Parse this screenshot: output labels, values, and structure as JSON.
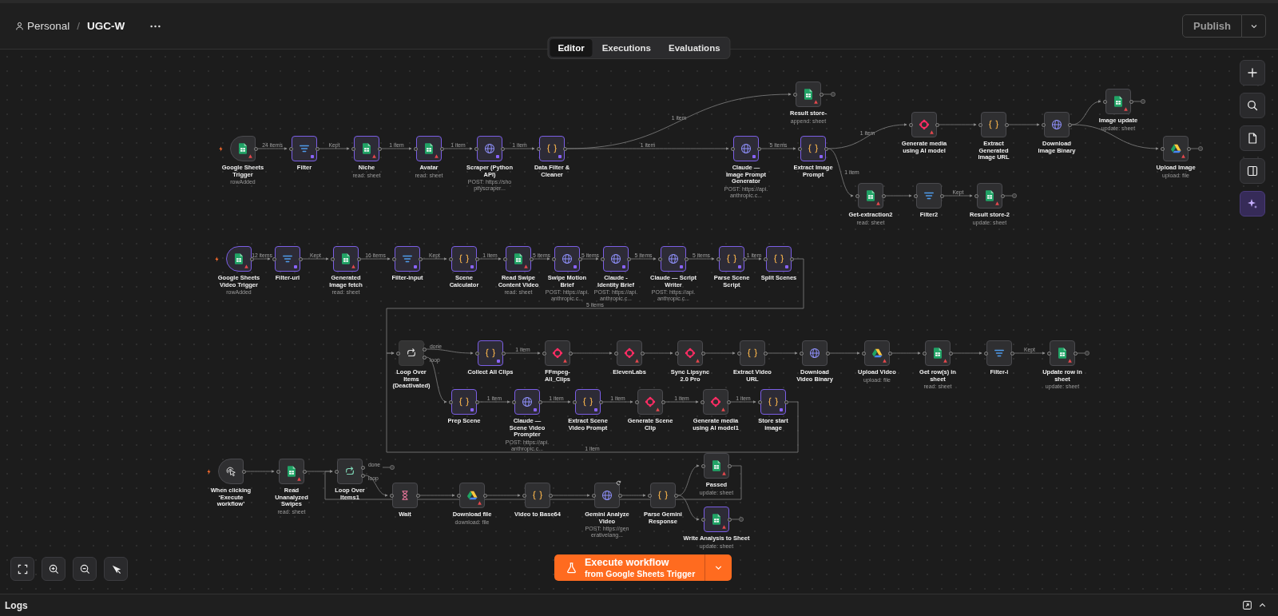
{
  "header": {
    "workspace": "Personal",
    "separator": "/",
    "workflow_name": "UGC-W",
    "publish_button": "Publish"
  },
  "tabs": [
    {
      "label": "Editor",
      "selected": true
    },
    {
      "label": "Executions",
      "selected": false
    },
    {
      "label": "Evaluations",
      "selected": false
    }
  ],
  "nodes": [
    {
      "name": "Google Sheets Trigger",
      "subtitle": "rowAdded",
      "kind": "sheets",
      "trigger": true,
      "pinned": false,
      "warning": true,
      "disabled": false,
      "out_labels": [
        "24 items"
      ]
    },
    {
      "name": "Filter",
      "kind": "filter",
      "trigger": false,
      "pinned": true,
      "warning": false,
      "disabled": false,
      "out_labels": [
        "Kept"
      ]
    },
    {
      "name": "Niche",
      "subtitle": "read: sheet",
      "kind": "sheets",
      "trigger": false,
      "pinned": true,
      "warning": true,
      "disabled": false,
      "out_labels": [
        "1 item"
      ]
    },
    {
      "name": "Avatar",
      "subtitle": "read: sheet",
      "kind": "sheets",
      "trigger": false,
      "pinned": true,
      "warning": true,
      "disabled": false,
      "out_labels": [
        "1 item"
      ]
    },
    {
      "name": "Scraper (Python API)",
      "subtitle": "POST: https://shopifyscraper...",
      "kind": "http",
      "trigger": false,
      "pinned": true,
      "warning": false,
      "disabled": false,
      "out_labels": [
        "1 item"
      ]
    },
    {
      "name": "Data Filter & Cleaner",
      "kind": "code",
      "trigger": false,
      "pinned": true,
      "warning": false,
      "disabled": false,
      "out_labels": [
        "1 item",
        "1 item"
      ]
    },
    {
      "name": "Result store-",
      "subtitle": "append: sheet",
      "kind": "sheets",
      "trigger": false,
      "pinned": false,
      "warning": true,
      "disabled": false,
      "end_handle": true
    },
    {
      "name": "Claude — Image Prompt Generator",
      "subtitle": "POST: https://api.anthropic.c...",
      "kind": "http",
      "trigger": false,
      "pinned": true,
      "warning": false,
      "disabled": false,
      "out_labels": [
        "5 items"
      ]
    },
    {
      "name": "Extract Image Prompt",
      "kind": "code",
      "trigger": false,
      "pinned": true,
      "warning": false,
      "disabled": false,
      "out_labels": [
        "1 item",
        "1 item"
      ]
    },
    {
      "name": "Generate media using AI model",
      "kind": "ai",
      "trigger": false,
      "pinned": false,
      "warning": true,
      "disabled": false
    },
    {
      "name": "Extract Generated Image URL",
      "kind": "code",
      "trigger": false,
      "pinned": false,
      "warning": false,
      "disabled": false
    },
    {
      "name": "Download Image Binary",
      "kind": "http",
      "trigger": false,
      "pinned": false,
      "warning": false,
      "disabled": false
    },
    {
      "name": "Image update",
      "subtitle": "update: sheet",
      "kind": "sheets",
      "trigger": false,
      "pinned": false,
      "warning": true,
      "disabled": false,
      "end_handle": true
    },
    {
      "name": "Upload Image",
      "subtitle": "upload: file",
      "kind": "drive",
      "trigger": false,
      "pinned": false,
      "warning": true,
      "disabled": false,
      "end_handle": true
    },
    {
      "name": "Get-extraction2",
      "subtitle": "read: sheet",
      "kind": "sheets",
      "trigger": false,
      "pinned": false,
      "warning": true,
      "disabled": false
    },
    {
      "name": "Filter2",
      "kind": "filter",
      "trigger": false,
      "pinned": false,
      "warning": false,
      "disabled": false,
      "out_labels": [
        "Kept"
      ]
    },
    {
      "name": "Result store-2",
      "subtitle": "update: sheet",
      "kind": "sheets",
      "trigger": false,
      "pinned": false,
      "warning": true,
      "disabled": false,
      "end_handle": true
    },
    {
      "name": "Google Sheets Video Trigger",
      "subtitle": "rowAdded",
      "kind": "sheets",
      "trigger": true,
      "pinned": true,
      "warning": true,
      "disabled": false,
      "out_labels": [
        "12 items"
      ]
    },
    {
      "name": "Filter-url",
      "kind": "filter",
      "trigger": false,
      "pinned": true,
      "warning": false,
      "disabled": false,
      "out_labels": [
        "Kept"
      ]
    },
    {
      "name": "Generated Image fetch",
      "subtitle": "read: sheet",
      "kind": "sheets",
      "trigger": false,
      "pinned": true,
      "warning": true,
      "disabled": false,
      "out_labels": [
        "16 items"
      ]
    },
    {
      "name": "Filter-input",
      "kind": "filter",
      "trigger": false,
      "pinned": true,
      "warning": false,
      "disabled": false,
      "out_labels": [
        "Kept"
      ]
    },
    {
      "name": "Scene Calculator",
      "kind": "code",
      "trigger": false,
      "pinned": true,
      "warning": false,
      "disabled": false,
      "out_labels": [
        "1 item"
      ]
    },
    {
      "name": "Read Swipe Content Video",
      "subtitle": "read: sheet",
      "kind": "sheets",
      "trigger": false,
      "pinned": true,
      "warning": true,
      "disabled": false,
      "out_labels": [
        "5 items"
      ]
    },
    {
      "name": "Swipe Motion Brief",
      "subtitle": "POST: https://api.anthropic.c...",
      "kind": "http",
      "trigger": false,
      "pinned": true,
      "warning": false,
      "disabled": false,
      "out_labels": [
        "5 items"
      ]
    },
    {
      "name": "Claude - Identity Brief",
      "subtitle": "POST: https://api.anthropic.c...",
      "kind": "http",
      "trigger": false,
      "pinned": true,
      "warning": false,
      "disabled": false,
      "out_labels": [
        "5 items"
      ]
    },
    {
      "name": "Claude — Script Writer",
      "subtitle": "POST: https://api.anthropic.c...",
      "kind": "http",
      "trigger": false,
      "pinned": true,
      "warning": false,
      "disabled": false,
      "out_labels": [
        "5 items"
      ]
    },
    {
      "name": "Parse Scene Script",
      "kind": "code",
      "trigger": false,
      "pinned": true,
      "warning": false,
      "disabled": false,
      "out_labels": [
        "1 item"
      ]
    },
    {
      "name": "Split Scenes",
      "kind": "code",
      "trigger": false,
      "pinned": true,
      "warning": false,
      "disabled": false,
      "out_labels": [
        "5 items"
      ]
    },
    {
      "name": "Loop Over Items (Deactivated)",
      "kind": "loop",
      "trigger": false,
      "pinned": false,
      "warning": false,
      "disabled": true,
      "out_labels": [
        "done",
        "loop"
      ]
    },
    {
      "name": "Collect All Clips",
      "kind": "code",
      "trigger": false,
      "pinned": true,
      "warning": false,
      "disabled": false,
      "out_labels": [
        "1 item"
      ]
    },
    {
      "name": "FFmpeg- All_Clips",
      "kind": "ai",
      "trigger": false,
      "pinned": false,
      "warning": true,
      "disabled": false
    },
    {
      "name": "ElevenLabs",
      "kind": "ai",
      "trigger": false,
      "pinned": false,
      "warning": true,
      "disabled": false
    },
    {
      "name": "Sync Lipsync 2.0 Pro",
      "kind": "ai",
      "trigger": false,
      "pinned": false,
      "warning": true,
      "disabled": false
    },
    {
      "name": "Extract Video URL",
      "kind": "code",
      "trigger": false,
      "pinned": false,
      "warning": false,
      "disabled": false
    },
    {
      "name": "Download Video Binary",
      "kind": "http",
      "trigger": false,
      "pinned": false,
      "warning": false,
      "disabled": false
    },
    {
      "name": "Upload Video",
      "subtitle": "upload: file",
      "kind": "drive",
      "trigger": false,
      "pinned": false,
      "warning": true,
      "disabled": false
    },
    {
      "name": "Get row(s) in sheet",
      "subtitle": "read: sheet",
      "kind": "sheets",
      "trigger": false,
      "pinned": false,
      "warning": true,
      "disabled": false
    },
    {
      "name": "Filter-i",
      "kind": "filter",
      "trigger": false,
      "pinned": false,
      "warning": false,
      "disabled": false,
      "out_labels": [
        "Kept"
      ]
    },
    {
      "name": "Update row in sheet",
      "subtitle": "update: sheet",
      "kind": "sheets",
      "trigger": false,
      "pinned": false,
      "warning": true,
      "disabled": false,
      "end_handle": true
    },
    {
      "name": "Prep Scene",
      "kind": "code",
      "trigger": false,
      "pinned": true,
      "warning": false,
      "disabled": false,
      "out_labels": [
        "1 item"
      ]
    },
    {
      "name": "Claude — Scene Video Prompter",
      "subtitle": "POST: https://api.anthropic.c...",
      "kind": "http",
      "trigger": false,
      "pinned": true,
      "warning": false,
      "disabled": false,
      "out_labels": [
        "1 item"
      ]
    },
    {
      "name": "Extract Scene Video Prompt",
      "kind": "code",
      "trigger": false,
      "pinned": true,
      "warning": false,
      "disabled": false,
      "out_labels": [
        "1 item"
      ]
    },
    {
      "name": "Generate Scene Clip",
      "kind": "ai",
      "trigger": false,
      "pinned": false,
      "warning": true,
      "disabled": false,
      "out_labels": [
        "1 item"
      ]
    },
    {
      "name": "Generate media using AI model1",
      "kind": "ai",
      "trigger": false,
      "pinned": false,
      "warning": true,
      "disabled": false,
      "out_labels": [
        "1 item"
      ]
    },
    {
      "name": "Store start image",
      "kind": "code",
      "trigger": false,
      "pinned": true,
      "warning": false,
      "disabled": false,
      "out_labels": [
        "1 item"
      ]
    },
    {
      "name": "When clicking ‘Execute workflow’",
      "kind": "manual",
      "trigger": true,
      "pinned": false,
      "warning": false,
      "disabled": false
    },
    {
      "name": "Read Unanalyzed Swipes",
      "subtitle": "read: sheet",
      "kind": "sheets",
      "trigger": false,
      "pinned": false,
      "warning": true,
      "disabled": false
    },
    {
      "name": "Loop Over Items1",
      "kind": "loop",
      "trigger": false,
      "pinned": false,
      "warning": false,
      "disabled": false,
      "out_labels": [
        "done",
        "loop"
      ],
      "end_handle": true
    },
    {
      "name": "Wait",
      "kind": "wait",
      "trigger": false,
      "pinned": false,
      "warning": false,
      "disabled": false
    },
    {
      "name": "Download file",
      "subtitle": "download: file",
      "kind": "drive",
      "trigger": false,
      "pinned": false,
      "warning": true,
      "disabled": false
    },
    {
      "name": "Video to Base64",
      "kind": "code",
      "trigger": false,
      "pinned": false,
      "warning": false,
      "disabled": false
    },
    {
      "name": "Gemini Analyze Video",
      "subtitle": "POST: https://generativelang...",
      "kind": "http",
      "trigger": false,
      "pinned": false,
      "warning": false,
      "disabled": false,
      "refresh_badge": true
    },
    {
      "name": "Parse Gemini Response",
      "kind": "code",
      "trigger": false,
      "pinned": false,
      "warning": false,
      "disabled": false
    },
    {
      "name": "Passed",
      "subtitle": "update: sheet",
      "kind": "sheets",
      "trigger": false,
      "pinned": false,
      "warning": true,
      "disabled": false
    },
    {
      "name": "Write Analysis to Sheet",
      "subtitle": "update: sheet",
      "kind": "sheets",
      "trigger": false,
      "pinned": true,
      "warning": true,
      "disabled": false,
      "end_handle": true
    }
  ],
  "execute_button": {
    "label": "Execute workflow",
    "sublabel": "from Google Sheets Trigger"
  },
  "logs": {
    "label": "Logs"
  }
}
